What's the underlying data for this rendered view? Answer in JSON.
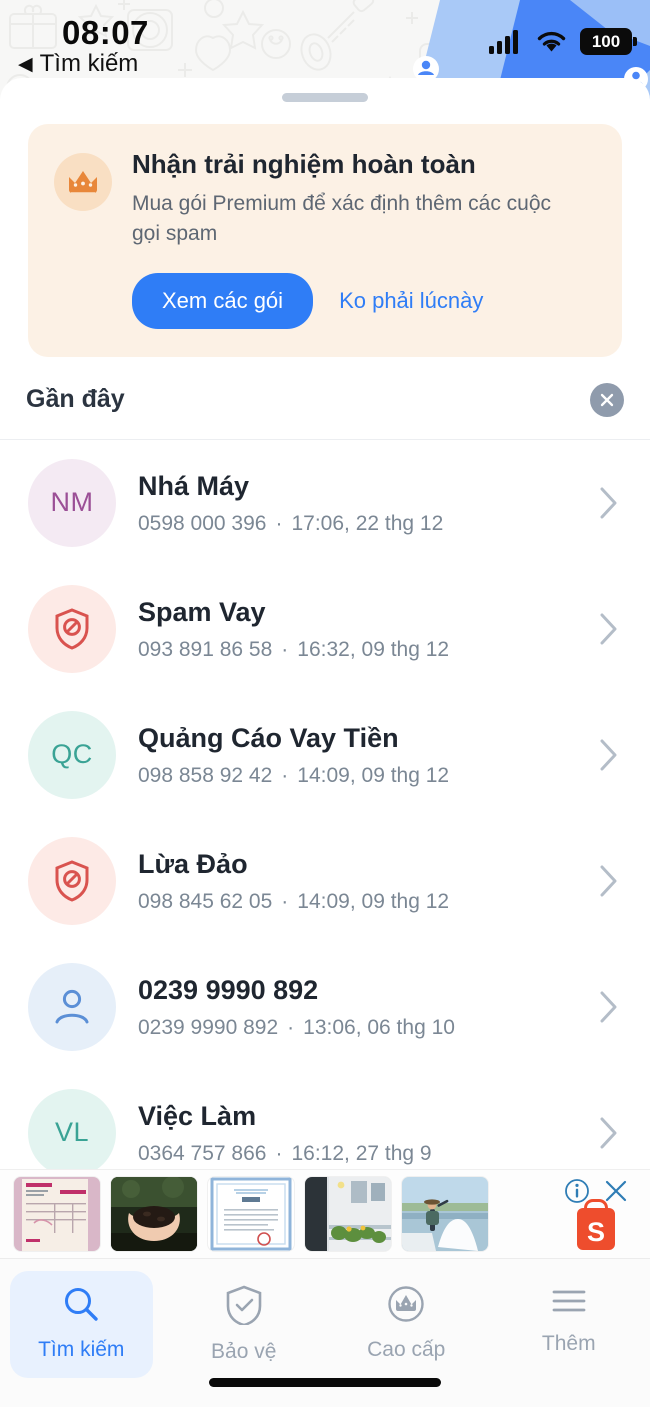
{
  "status_bar": {
    "time": "08:07",
    "back_label": "Tìm kiếm",
    "back_caret": "◀",
    "battery_level": "100",
    "signal_icon": "cellular-signal-icon",
    "wifi_icon": "wifi-icon",
    "battery_icon": "battery-icon"
  },
  "promo": {
    "icon": "crown-icon",
    "title": "Nhận trải nghiệm hoàn toàn",
    "subtitle": "Mua gói Premium để xác định thêm các cuộc gọi spam",
    "primary_button": "Xem các gói",
    "dismiss_button": "Ko phải lúcnày",
    "accent_color": "#2f7df6",
    "background_color": "#fcf1e5"
  },
  "recent": {
    "title": "Gần đây",
    "close_icon": "close-icon",
    "items": [
      {
        "name": "Nhá Máy",
        "number": "0598 000 396",
        "timestamp": "17:06, 22 thg 12",
        "avatar_type": "initials",
        "initials": "NM",
        "avatar_bg": "#f4eaf3",
        "avatar_fg": "#9b4f96",
        "chevron": "chevron-right-icon"
      },
      {
        "name": "Spam Vay",
        "number": "093 891 86 58",
        "timestamp": "16:32, 09 thg 12",
        "avatar_type": "spam-shield",
        "initials": "",
        "avatar_bg": "#fdeae6",
        "avatar_fg": "#d9534f",
        "chevron": "chevron-right-icon"
      },
      {
        "name": "Quảng Cáo Vay Tiền",
        "number": "098 858 92 42",
        "timestamp": "14:09, 09 thg 12",
        "avatar_type": "initials",
        "initials": "QC",
        "avatar_bg": "#e3f4f0",
        "avatar_fg": "#3aa395",
        "chevron": "chevron-right-icon"
      },
      {
        "name": "Lừa Đảo",
        "number": "098 845 62 05",
        "timestamp": "14:09, 09 thg 12",
        "avatar_type": "spam-shield",
        "initials": "",
        "avatar_bg": "#fdeae6",
        "avatar_fg": "#d9534f",
        "chevron": "chevron-right-icon"
      },
      {
        "name": "0239 9990 892",
        "number": "0239 9990 892",
        "timestamp": "13:06, 06 thg 10",
        "avatar_type": "person",
        "initials": "",
        "avatar_bg": "#e6eff9",
        "avatar_fg": "#5b8fd6",
        "chevron": "chevron-right-icon"
      },
      {
        "name": "Việc Làm",
        "number": "0364 757 866",
        "timestamp": "16:12, 27 thg 9",
        "avatar_type": "initials",
        "initials": "VL",
        "avatar_bg": "#e3f4f0",
        "avatar_fg": "#3aa395",
        "chevron": "chevron-right-icon"
      }
    ],
    "separator": "·"
  },
  "ad": {
    "info_icon": "info-icon",
    "close_icon": "close-icon",
    "brand_icon": "shopee-bag-icon",
    "brand_letter": "S",
    "thumbnails": [
      {
        "name": "pink-invoice-thumbnail"
      },
      {
        "name": "hands-holding-soil-thumbnail"
      },
      {
        "name": "certificate-document-thumbnail"
      },
      {
        "name": "balcony-plants-thumbnail"
      },
      {
        "name": "salt-field-worker-thumbnail"
      }
    ]
  },
  "tabbar": {
    "tabs": [
      {
        "label": "Tìm kiếm",
        "icon": "search-icon",
        "active": true
      },
      {
        "label": "Bảo vệ",
        "icon": "shield-check-icon",
        "active": false
      },
      {
        "label": "Cao cấp",
        "icon": "crown-circle-icon",
        "active": false
      },
      {
        "label": "Thêm",
        "icon": "menu-icon",
        "active": false
      }
    ]
  }
}
